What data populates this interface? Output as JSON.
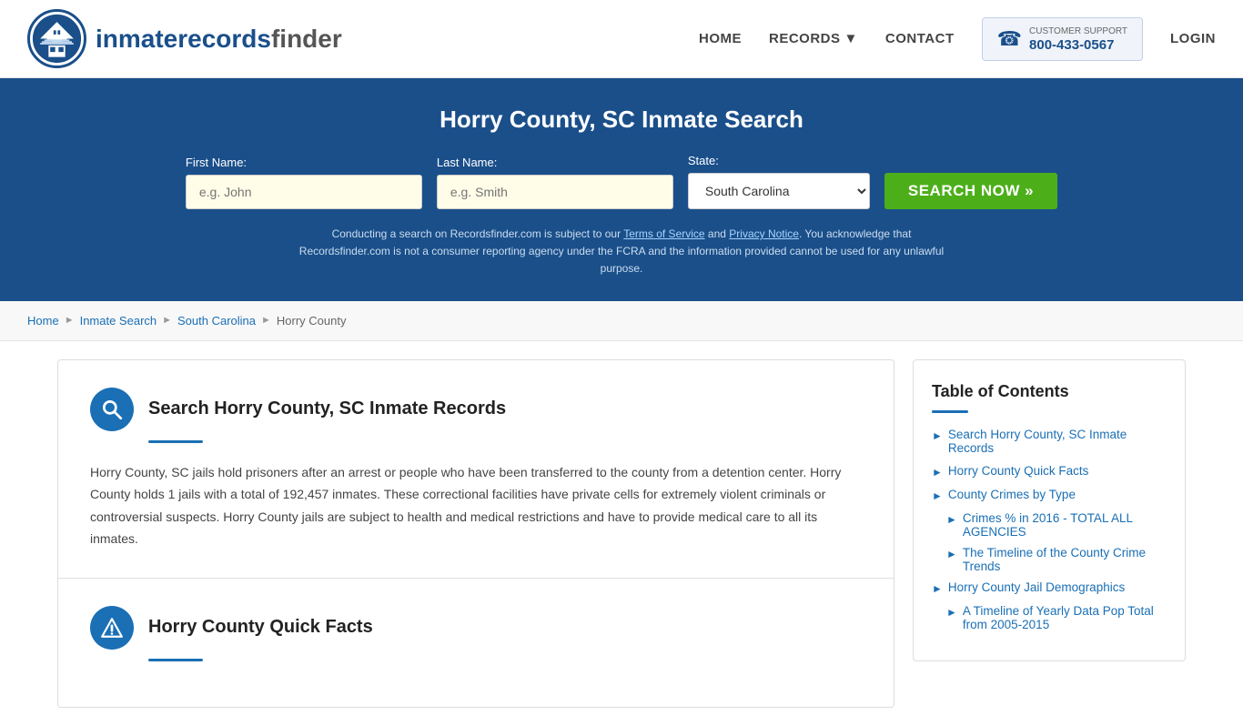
{
  "header": {
    "logo_text_main": "inmaterecords",
    "logo_text_bold": "finder",
    "nav": {
      "home": "HOME",
      "records": "RECORDS",
      "contact": "CONTACT",
      "login": "LOGIN"
    },
    "support": {
      "label": "CUSTOMER SUPPORT",
      "phone": "800-433-0567"
    }
  },
  "banner": {
    "title": "Horry County, SC Inmate Search",
    "first_name_label": "First Name:",
    "first_name_placeholder": "e.g. John",
    "last_name_label": "Last Name:",
    "last_name_placeholder": "e.g. Smith",
    "state_label": "State:",
    "state_value": "South Carolina",
    "search_button": "SEARCH NOW »",
    "disclaimer": "Conducting a search on Recordsfinder.com is subject to our Terms of Service and Privacy Notice. You acknowledge that Recordsfinder.com is not a consumer reporting agency under the FCRA and the information provided cannot be used for any unlawful purpose.",
    "terms_link": "Terms of Service",
    "privacy_link": "Privacy Notice"
  },
  "breadcrumb": {
    "home": "Home",
    "inmate_search": "Inmate Search",
    "south_carolina": "South Carolina",
    "current": "Horry County"
  },
  "main": {
    "section1": {
      "title": "Search Horry County, SC Inmate Records",
      "body": "Horry County, SC jails hold prisoners after an arrest or people who have been transferred to the county from a detention center. Horry County holds 1 jails with a total of 192,457 inmates. These correctional facilities have private cells for extremely violent criminals or controversial suspects. Horry County jails are subject to health and medical restrictions and have to provide medical care to all its inmates."
    },
    "section2": {
      "title": "Horry County Quick Facts"
    }
  },
  "toc": {
    "title": "Table of Contents",
    "items": [
      {
        "label": "Search Horry County, SC Inmate Records"
      },
      {
        "label": "Horry County Quick Facts"
      },
      {
        "label": "County Crimes by Type"
      },
      {
        "label": "Crimes % in 2016 - TOTAL ALL AGENCIES",
        "sub": true
      },
      {
        "label": "The Timeline of the County Crime Trends",
        "sub": true
      },
      {
        "label": "Horry County Jail Demographics"
      },
      {
        "label": "A Timeline of Yearly Data Pop Total from 2005-2015",
        "sub": true
      }
    ]
  }
}
